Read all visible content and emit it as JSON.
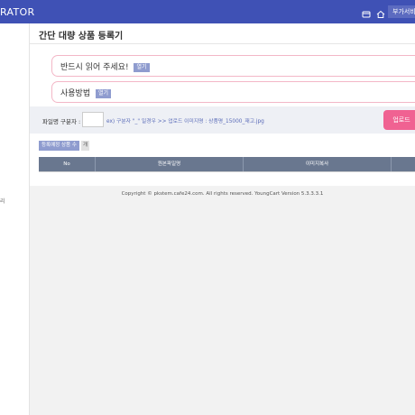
{
  "header": {
    "brand": "RATOR",
    "addon_label": "부가서비스",
    "icons": [
      "window-icon",
      "home-icon"
    ]
  },
  "sidebar": {
    "fragment": "리"
  },
  "page": {
    "title": "간단 대량 상품 등록기",
    "notice_must_read": "반드시 읽어 주세요!",
    "notice_usage": "사용방법",
    "open_label": "열기",
    "separator_label": "파일명 구분자 :",
    "separator_value": "",
    "hint": "ex) 구분자 \"_\" 일경우 >> 업로드 이미지명 : 상품명_15000_재고.jpg",
    "upload_label": "업로드",
    "count_label": "등록예정 상품 수",
    "count_value": "개",
    "columns": [
      "No",
      "원본파일명",
      "이미지복사",
      ""
    ]
  },
  "footer": {
    "text": "Copyright © pkstem.cafe24.com. All rights reserved. YoungCart Version 5.3.3.3.1"
  },
  "colors": {
    "topbar": "#3f51b5",
    "badge": "#8f9ccf",
    "upload_button": "#f06292",
    "table_header": "#69778f",
    "notice_border": "#f3b7c7"
  }
}
